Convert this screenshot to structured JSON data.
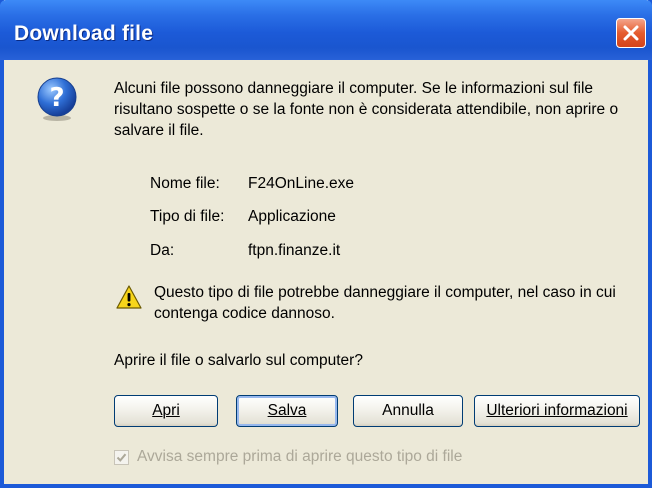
{
  "window": {
    "title": "Download file",
    "colors": {
      "titlebar": "#1c5ad8",
      "dialog_bg": "#ece9d8",
      "close": "#e55c2e"
    }
  },
  "message": "Alcuni file possono danneggiare il computer. Se le informazioni sul file risultano sospette o se la fonte non è considerata attendibile, non aprire o salvare il file.",
  "file_info": [
    {
      "label": "Nome file:",
      "value": "F24OnLine.exe"
    },
    {
      "label": "Tipo di file:",
      "value": "Applicazione"
    },
    {
      "label": "Da:",
      "value": "ftpn.finanze.it"
    }
  ],
  "warning": "Questo tipo di file potrebbe danneggiare il computer, nel caso in cui contenga codice dannoso.",
  "question": "Aprire il file o salvarlo sul computer?",
  "buttons": {
    "open": "Apri",
    "save": "Salva",
    "cancel": "Annulla",
    "more_info": "Ulteriori informazioni"
  },
  "always_ask": {
    "label": "Avvisa sempre prima di aprire questo tipo di file",
    "checked": true,
    "enabled": false
  },
  "icons": [
    "question-icon",
    "warning-icon",
    "close-icon",
    "checkmark-icon"
  ]
}
